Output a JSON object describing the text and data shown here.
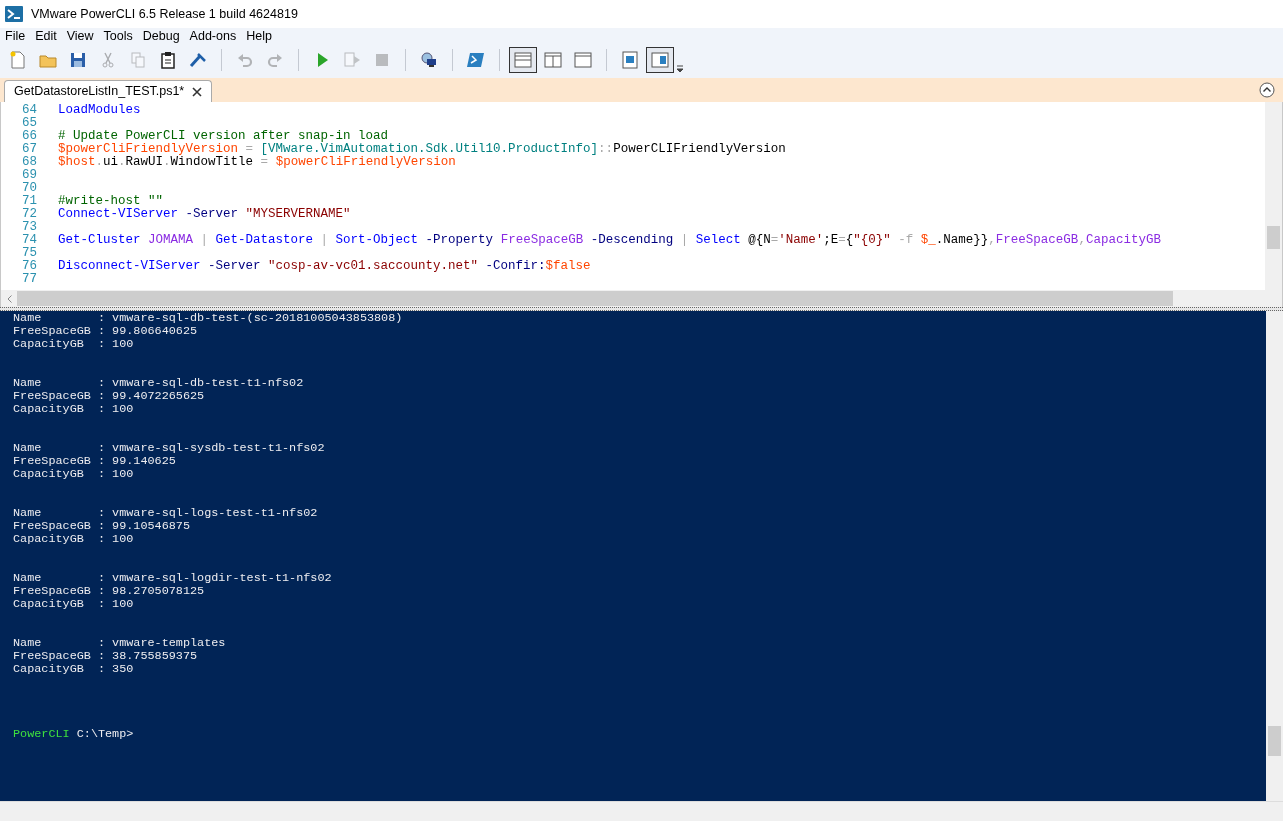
{
  "window": {
    "title": "VMware PowerCLI 6.5 Release 1 build 4624819"
  },
  "menu": [
    "File",
    "Edit",
    "View",
    "Tools",
    "Debug",
    "Add-ons",
    "Help"
  ],
  "toolbar": [
    {
      "kind": "new",
      "disabled": false,
      "pressed": false
    },
    {
      "kind": "open",
      "disabled": false,
      "pressed": false
    },
    {
      "kind": "save",
      "disabled": false,
      "pressed": false
    },
    {
      "kind": "cut",
      "disabled": true,
      "pressed": false
    },
    {
      "kind": "copy",
      "disabled": true,
      "pressed": false
    },
    {
      "kind": "paste",
      "disabled": false,
      "pressed": false
    },
    {
      "kind": "clear",
      "disabled": false,
      "pressed": false
    },
    {
      "kind": "sep"
    },
    {
      "kind": "undo",
      "disabled": true,
      "pressed": false
    },
    {
      "kind": "redo",
      "disabled": true,
      "pressed": false
    },
    {
      "kind": "sep"
    },
    {
      "kind": "run",
      "disabled": false,
      "pressed": false
    },
    {
      "kind": "runsel",
      "disabled": true,
      "pressed": false
    },
    {
      "kind": "stop",
      "disabled": true,
      "pressed": false
    },
    {
      "kind": "sep"
    },
    {
      "kind": "remote",
      "disabled": false,
      "pressed": false
    },
    {
      "kind": "sep"
    },
    {
      "kind": "console",
      "disabled": false,
      "pressed": false
    },
    {
      "kind": "sep"
    },
    {
      "kind": "paneTop",
      "disabled": false,
      "pressed": true
    },
    {
      "kind": "paneRight",
      "disabled": false,
      "pressed": false
    },
    {
      "kind": "paneMax",
      "disabled": false,
      "pressed": false
    },
    {
      "kind": "sep"
    },
    {
      "kind": "addon",
      "disabled": false,
      "pressed": false
    },
    {
      "kind": "commands",
      "disabled": false,
      "pressed": true
    }
  ],
  "tabs": [
    {
      "label": "GetDatastoreListIn_TEST.ps1*",
      "selected": true
    }
  ],
  "editor": {
    "lines": [
      {
        "number": "64",
        "tokens": [
          {
            "text": "LoadModules",
            "kind": "command"
          }
        ]
      },
      {
        "number": "65"
      },
      {
        "number": "66",
        "tokens": [
          {
            "text": "# Update PowerCLI version after snap-in load",
            "kind": "comment"
          }
        ]
      },
      {
        "number": "67",
        "tokens": [
          {
            "text": "$powerCliFriendlyVersion",
            "kind": "variable"
          },
          {
            "text": " = ",
            "kind": "operator"
          },
          {
            "text": "[VMware.VimAutomation.Sdk.Util10.ProductInfo]",
            "kind": "type"
          },
          {
            "text": "::",
            "kind": "operator"
          },
          {
            "text": "PowerCLIFriendlyVersion",
            "kind": "member"
          }
        ]
      },
      {
        "number": "68",
        "tokens": [
          {
            "text": "$host",
            "kind": "variable"
          },
          {
            "text": ".",
            "kind": "operator"
          },
          {
            "text": "ui",
            "kind": "member"
          },
          {
            "text": ".",
            "kind": "operator"
          },
          {
            "text": "RawUI",
            "kind": "member"
          },
          {
            "text": ".",
            "kind": "operator"
          },
          {
            "text": "WindowTitle",
            "kind": "member"
          },
          {
            "text": " = ",
            "kind": "operator"
          },
          {
            "text": "$powerCliFriendlyVersion",
            "kind": "variable"
          }
        ]
      },
      {
        "number": "69"
      },
      {
        "number": "70"
      },
      {
        "number": "71",
        "tokens": [
          {
            "text": "#write-host \"\"",
            "kind": "comment"
          }
        ]
      },
      {
        "number": "72",
        "tokens": [
          {
            "text": "Connect-VIServer",
            "kind": "command"
          },
          {
            "text": " -Server",
            "kind": "parameter"
          },
          {
            "text": " \"MYSERVERNAME\"",
            "kind": "string"
          }
        ]
      },
      {
        "number": "73"
      },
      {
        "number": "74",
        "tokens": [
          {
            "text": "Get-Cluster",
            "kind": "command"
          },
          {
            "text": " JOMAMA",
            "kind": "argument"
          },
          {
            "text": " | ",
            "kind": "operator"
          },
          {
            "text": "Get-Datastore",
            "kind": "command"
          },
          {
            "text": " | ",
            "kind": "operator"
          },
          {
            "text": "Sort-Object",
            "kind": "command"
          },
          {
            "text": " -Property",
            "kind": "parameter"
          },
          {
            "text": " FreeSpaceGB",
            "kind": "argument"
          },
          {
            "text": " -Descending",
            "kind": "parameter"
          },
          {
            "text": " | ",
            "kind": "operator"
          },
          {
            "text": "Select",
            "kind": "command"
          },
          {
            "text": " @{N",
            "kind": "plain"
          },
          {
            "text": "=",
            "kind": "operator"
          },
          {
            "text": "'Name'",
            "kind": "string"
          },
          {
            "text": ";E",
            "kind": "plain"
          },
          {
            "text": "=",
            "kind": "operator"
          },
          {
            "text": "{",
            "kind": "plain"
          },
          {
            "text": "\"{0}\"",
            "kind": "string"
          },
          {
            "text": " -f ",
            "kind": "operator"
          },
          {
            "text": "$_",
            "kind": "variable"
          },
          {
            "text": ".Name}}",
            "kind": "plain"
          },
          {
            "text": ",",
            "kind": "operator"
          },
          {
            "text": "FreeSpaceGB",
            "kind": "argument"
          },
          {
            "text": ",",
            "kind": "operator"
          },
          {
            "text": "CapacityGB",
            "kind": "argument"
          }
        ]
      },
      {
        "number": "75"
      },
      {
        "number": "76",
        "tokens": [
          {
            "text": "Disconnect-VIServer",
            "kind": "command"
          },
          {
            "text": " -Server",
            "kind": "parameter"
          },
          {
            "text": " \"cosp-av-vc01.saccounty.net\"",
            "kind": "string"
          },
          {
            "text": " -Confir:",
            "kind": "parameter"
          },
          {
            "text": "$false",
            "kind": "variable"
          }
        ]
      },
      {
        "number": "77"
      }
    ]
  },
  "console": {
    "records": [
      {
        "name": "Name        : vmware-sql-db-test-(sc-20181005043853808)",
        "free": "FreeSpaceGB : 99.806640625",
        "capacity": "CapacityGB  : 100"
      },
      {
        "name": "Name        : vmware-sql-db-test-t1-nfs02",
        "free": "FreeSpaceGB : 99.4072265625",
        "capacity": "CapacityGB  : 100"
      },
      {
        "name": "Name        : vmware-sql-sysdb-test-t1-nfs02",
        "free": "FreeSpaceGB : 99.140625",
        "capacity": "CapacityGB  : 100"
      },
      {
        "name": "Name        : vmware-sql-logs-test-t1-nfs02",
        "free": "FreeSpaceGB : 99.10546875",
        "capacity": "CapacityGB  : 100"
      },
      {
        "name": "Name        : vmware-sql-logdir-test-t1-nfs02",
        "free": "FreeSpaceGB : 98.2705078125",
        "capacity": "CapacityGB  : 100"
      },
      {
        "name": "Name        : vmware-templates",
        "free": "FreeSpaceGB : 38.755859375",
        "capacity": "CapacityGB  : 350"
      }
    ],
    "prompt": {
      "label": "PowerCLI",
      "path": " C:\\Temp>"
    }
  }
}
